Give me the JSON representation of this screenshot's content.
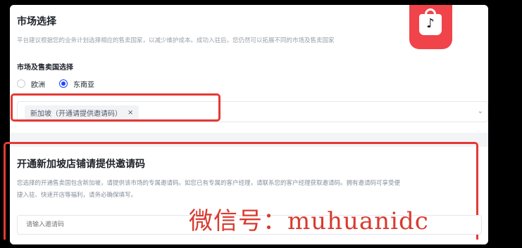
{
  "market": {
    "title": "市场选择",
    "description": "平台建议根据您的业务计划选择相应的售卖国家，以减少维护成本。成功入驻后，您仍然可以拓展不同的市场及售卖国家",
    "region_label": "市场及售卖国选择",
    "options": [
      {
        "label": "欧洲",
        "selected": false
      },
      {
        "label": "东南亚",
        "selected": true
      }
    ],
    "selected_tag": "新加坡（开通请提供邀请码）",
    "tag_close": "×",
    "chevron": "⌄"
  },
  "invite": {
    "title": "开通新加坡店铺请提供邀请码",
    "description_line1": "您选择的开通售卖国包含新加坡，请提供该市场的专属邀请码。如您已有专属的客户经理，请联系您的客户经理获取邀请码。拥有邀请码可享受便",
    "description_line2": "捷入驻、快速开店等福利，请务必确保填写。",
    "input_placeholder": "请输入邀请码"
  },
  "watermark": "微信号：muhuanidc",
  "logo": {
    "icon": "tiktok-shop-bag-icon",
    "note": "♪",
    "color": "#f0444a"
  },
  "colors": {
    "accent": "#1f45ff",
    "highlight": "#e53935",
    "watermark": "#d83b2f"
  }
}
